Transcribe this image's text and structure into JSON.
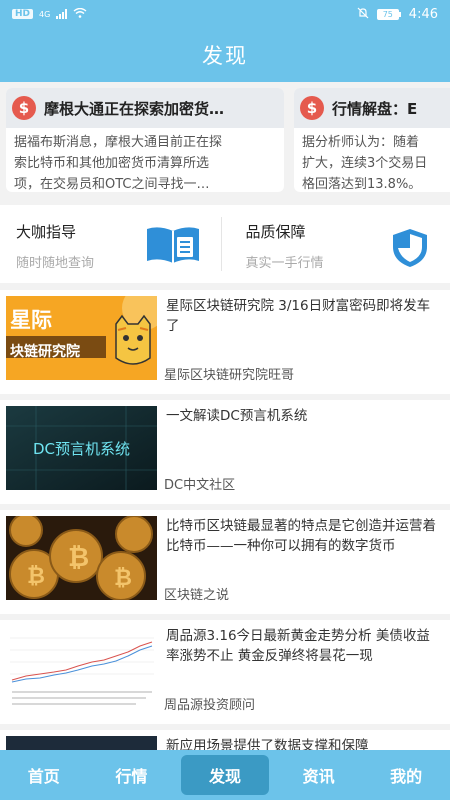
{
  "status_bar": {
    "left_badge": "HD",
    "network": "4G",
    "battery": "75",
    "time": "4:46"
  },
  "header": {
    "title": "发现"
  },
  "news_cards": [
    {
      "icon": "$",
      "title": "摩根大通正在探索加密货…",
      "lines": [
        "据福布斯消息，摩根大通目前正在探",
        "索比特币和其他加密货币清算所选",
        "项，在交易员和OTC之间寻找一…"
      ]
    },
    {
      "icon": "$",
      "title": "行情解盘：E",
      "lines": [
        "据分析师认为：随着",
        "扩大，连续3个交易日",
        "格回落达到13.8%。"
      ]
    }
  ],
  "guides": [
    {
      "title": "大咖指导",
      "subtitle": "随时随地查询",
      "icon": "book-icon"
    },
    {
      "title": "品质保障",
      "subtitle": "真实一手行情",
      "icon": "shield-icon"
    }
  ],
  "articles": [
    {
      "title": "星际区块链研究院 3/16日财富密码即将发车了",
      "source": "星际区块链研究院旺哥",
      "thumb_text_1": "星际",
      "thumb_text_2": "块链研究院",
      "thumb_icon": "cartoon-cat-icon"
    },
    {
      "title": "一文解读DC预言机系统",
      "source": "DC中文社区",
      "thumb_text_1": "DC预言机系统"
    },
    {
      "title": "比特币区块链最显著的特点是它创造并运营着比特币——一种你可以拥有的数字货币",
      "source": "区块链之说",
      "thumb_icon": "bitcoin-coins-icon"
    },
    {
      "title": "周品源3.16今日最新黄金走势分析 美债收益率涨势不止 黄金反弹终将昙花一现",
      "source": "周品源投资顾问",
      "thumb_icon": "gold-chart-icon"
    },
    {
      "title": "新应用场景提供了数据支撑和保障",
      "source": ""
    }
  ],
  "tabbar": {
    "tabs": [
      "首页",
      "行情",
      "发现",
      "资讯",
      "我的"
    ],
    "active": "发现"
  },
  "colors": {
    "primary": "#6cc3ea",
    "active_tab": "#3b9ac4",
    "icon_blue": "#2f8fd8",
    "dollar_red": "#e55a4e"
  }
}
